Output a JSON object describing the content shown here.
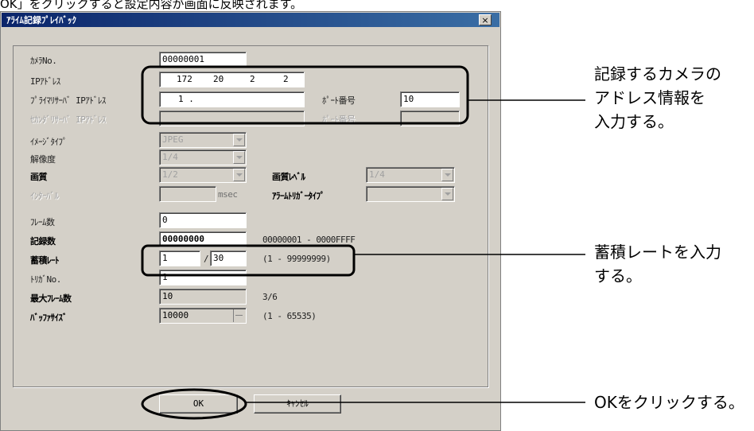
{
  "top_text": "OK」をクリックすると設定内容が画面に反映されます。",
  "dialog": {
    "title": "ｱﾗｲﾑ記録ﾌﾟﾚｲﾊﾞｯｸ",
    "close_label": "×",
    "fields": {
      "camera_no": {
        "label": "ｶﾒﾗNo.",
        "value": "00000001"
      },
      "ip_address": {
        "label": "IPｱﾄﾞﾚｽ",
        "octets": [
          "172",
          "20",
          "2",
          "2"
        ]
      },
      "primary_server": {
        "label": "ﾌﾟﾗｲﾏﾘｻｰﾊﾞ IPｱﾄﾞﾚｽ",
        "value": "1 .",
        "port_label": "ﾎﾟｰﾄ番号",
        "port_value": "10"
      },
      "secondary_server": {
        "label": "ｾｶﾝﾀﾞﾘｻｰﾊﾞ IPｱﾄﾞﾚｽ",
        "value": "",
        "port_label": "ﾎﾟｰﾄ番号",
        "port_value": ""
      },
      "image_type": {
        "label": "ｲﾒｰｼﾞﾀｲﾌﾟ",
        "value": "JPEG"
      },
      "resolution": {
        "label": "解像度",
        "value": "1/4"
      },
      "image_quality": {
        "label": "画質",
        "value": "1/2",
        "label2": "画質ﾚﾍﾞﾙ",
        "value2": "1/4"
      },
      "interval": {
        "label": "ｲﾝﾀｰﾊﾞﾙ",
        "value": "",
        "unit": "msec",
        "label2": "ｱﾗｰﾑﾄﾘｶﾞｰﾀｲﾌﾟ",
        "value2": ""
      },
      "frame_count": {
        "label": "ﾌﾚｰﾑ数",
        "value": "0"
      },
      "record_count": {
        "label": "記録数",
        "value": "00000000",
        "range": "00000001 - 0000FFFF"
      },
      "storage_rate": {
        "label": "蓄積ﾚｰﾄ",
        "value1": "1",
        "separator": "/",
        "value2": "30",
        "range": "(1 - 99999999)"
      },
      "trigger_no": {
        "label": "ﾄﾘｶﾞNo.",
        "value": "1"
      },
      "max_frames": {
        "label": "最大ﾌﾚｰﾑ数",
        "value": "10",
        "unit": "3/6"
      },
      "buffer_size": {
        "label": "ﾊﾞｯﾌｧｻｲｽﾞ",
        "value": "10000",
        "range": "(1 - 65535)"
      }
    },
    "ok_label": "OK",
    "cancel_label": "ｷｬﾝｾﾙ"
  },
  "callouts": {
    "address": "記録するカメラの\nアドレス情報を\n入力する。",
    "rate": "蓄積レートを入力\nする。",
    "ok": "OKをクリックする。"
  }
}
